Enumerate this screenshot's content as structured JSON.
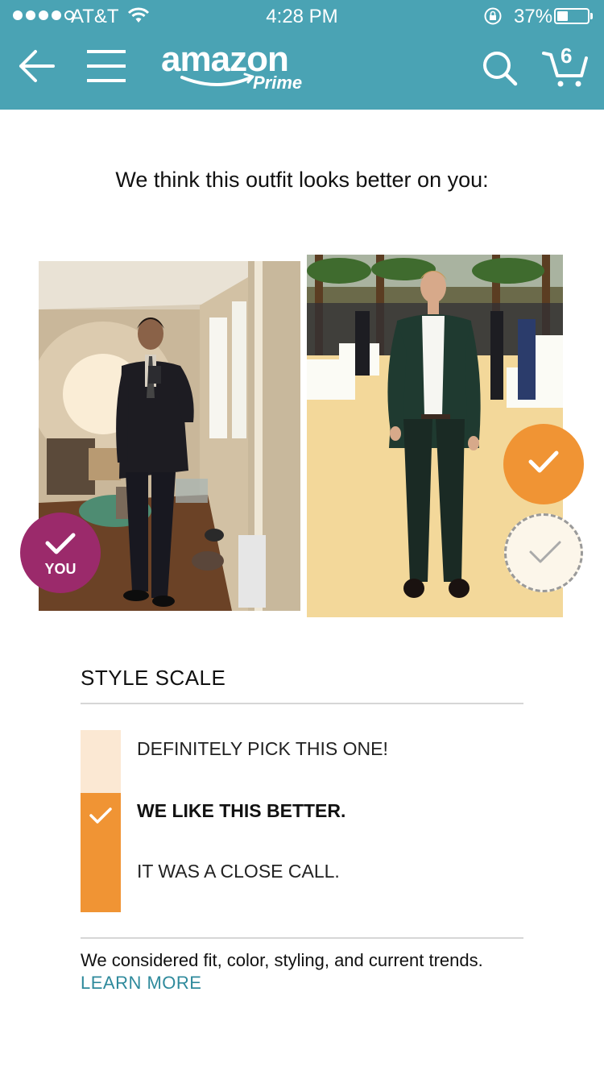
{
  "status_bar": {
    "carrier": "AT&T",
    "time": "4:28 PM",
    "battery_percent": "37%",
    "battery_level": 0.37,
    "signal_bars": 4
  },
  "nav": {
    "logo_text": "amazon",
    "logo_sub": "Prime",
    "cart_count": "6"
  },
  "headline": "We think this outfit looks better on you:",
  "photos": {
    "you_label": "YOU"
  },
  "style_scale": {
    "title": "STYLE SCALE",
    "options": [
      "DEFINITELY PICK THIS ONE!",
      "WE LIKE THIS BETTER.",
      "IT WAS A CLOSE CALL."
    ],
    "selected_index": 1
  },
  "footer": {
    "text": "We considered fit, color, styling, and current trends.",
    "link": "LEARN MORE"
  },
  "colors": {
    "header": "#4aa3b4",
    "you_badge": "#9b2a6b",
    "accent_orange": "#f09434",
    "light_orange": "#fbe8d3",
    "link": "#2f8a9c"
  }
}
